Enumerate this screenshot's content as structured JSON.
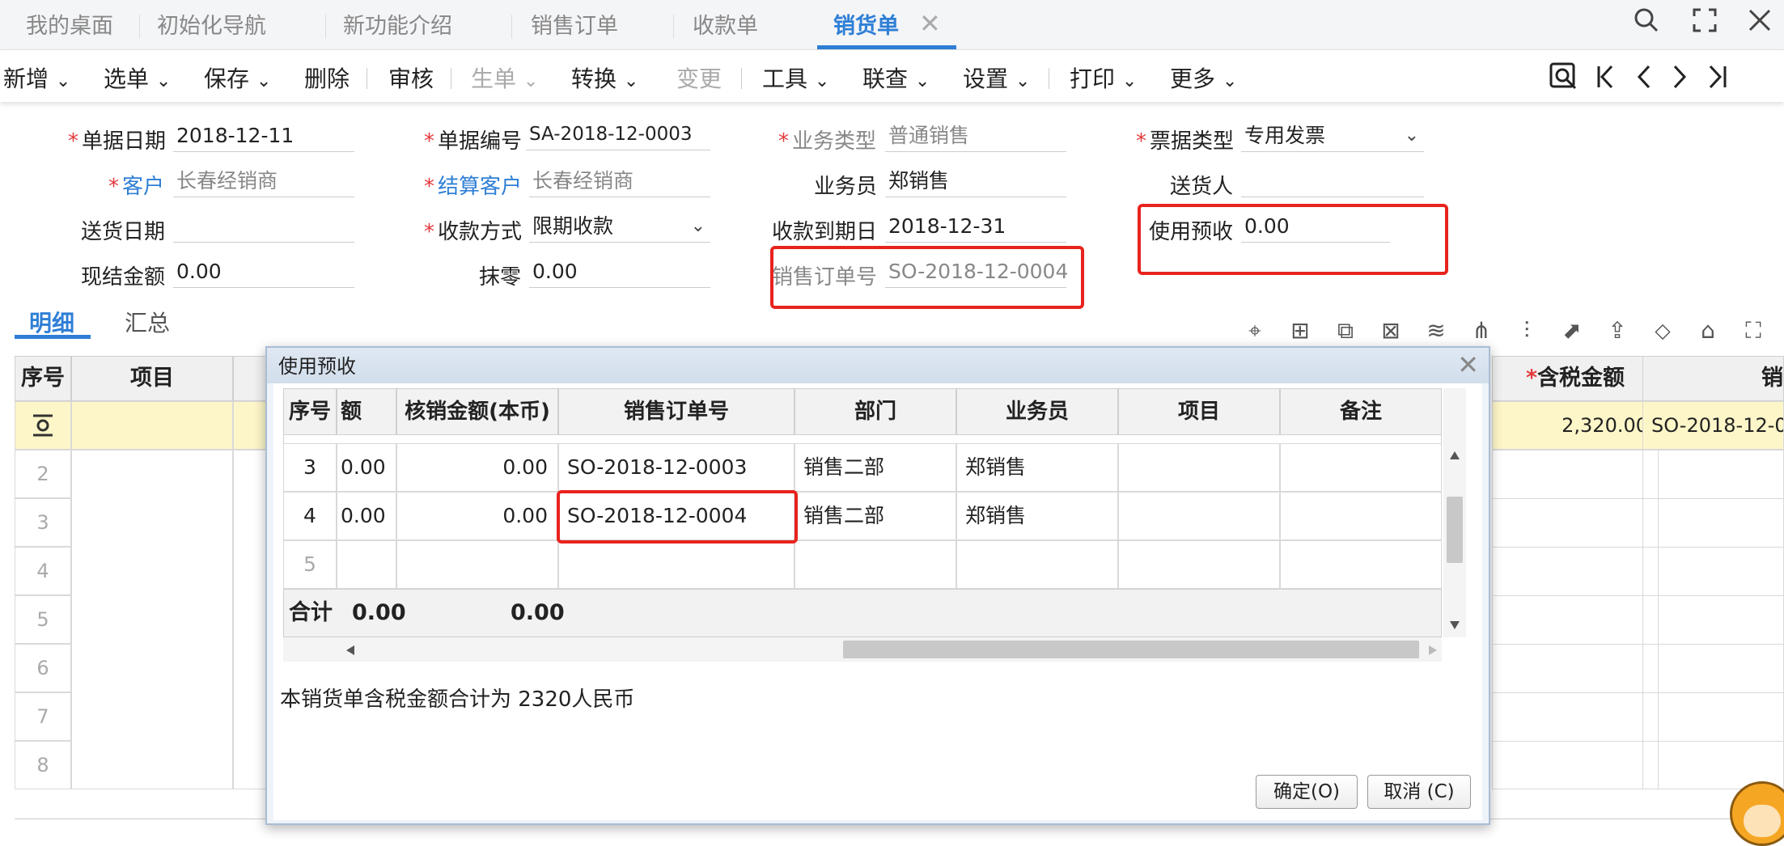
{
  "tabs": [
    "我的桌面",
    "初始化导航",
    "新功能介绍",
    "销售订单",
    "收款单",
    "销货单"
  ],
  "tab_close": "✕",
  "toolbar": {
    "items": [
      "新增",
      "选单",
      "保存",
      "删除",
      "审核",
      "生单",
      "转换",
      "变更",
      "工具",
      "联查",
      "设置",
      "打印",
      "更多"
    ],
    "caret": "⌄"
  },
  "form": {
    "doc_date_label": "单据日期",
    "doc_date": "2018-12-11",
    "doc_no_label": "单据编号",
    "doc_no": "SA-2018-12-0003",
    "biz_type_label": "业务类型",
    "biz_type": "普通销售",
    "invoice_type_label": "票据类型",
    "invoice_type": "专用发票",
    "customer_label": "客户",
    "customer": "长春经销商",
    "settle_customer_label": "结算客户",
    "settle_customer": "长春经销商",
    "salesman_label": "业务员",
    "salesman": "郑销售",
    "deliverer_label": "送货人",
    "deliverer": "",
    "delivery_date_label": "送货日期",
    "delivery_date": "",
    "pay_method_label": "收款方式",
    "pay_method": "限期收款",
    "due_date_label": "收款到期日",
    "due_date": "2018-12-31",
    "use_prepay_label": "使用预收",
    "use_prepay": "0.00",
    "cash_amount_label": "现结金额",
    "cash_amount": "0.00",
    "rounding_label": "抹零",
    "rounding": "0.00",
    "so_no_label": "销售订单号",
    "so_no": "SO-2018-12-0004",
    "required_mark": "*"
  },
  "detail_tabs": [
    "明细",
    "汇总"
  ],
  "grid": {
    "headers": {
      "seq": "序号",
      "item": "项目",
      "tax_amount": "含税金额",
      "partial": "销"
    },
    "row1_amount": "2,320.00",
    "row1_so": "SO-2018-12-0",
    "row_numbers": [
      "2",
      "3",
      "4",
      "5",
      "6",
      "7",
      "8"
    ]
  },
  "dialog": {
    "title": "使用预收",
    "close": "✕",
    "headers": [
      "序号",
      "额",
      "核销金额(本币)",
      "销售订单号",
      "部门",
      "业务员",
      "项目",
      "备注"
    ],
    "rows": [
      {
        "seq": "3",
        "amt": "0.00",
        "write_off": "0.00",
        "so": "SO-2018-12-0003",
        "dept": "销售二部",
        "sales": "郑销售"
      },
      {
        "seq": "4",
        "amt": "0.00",
        "write_off": "0.00",
        "so": "SO-2018-12-0004",
        "dept": "销售二部",
        "sales": "郑销售"
      },
      {
        "seq": "5"
      }
    ],
    "total_label": "合计",
    "total_amt": "0.00",
    "total_write_off": "0.00",
    "note": "本销货单含税金额合计为 2320人民币",
    "ok_label": "确定(O)",
    "cancel_label": "取消 (C)"
  }
}
